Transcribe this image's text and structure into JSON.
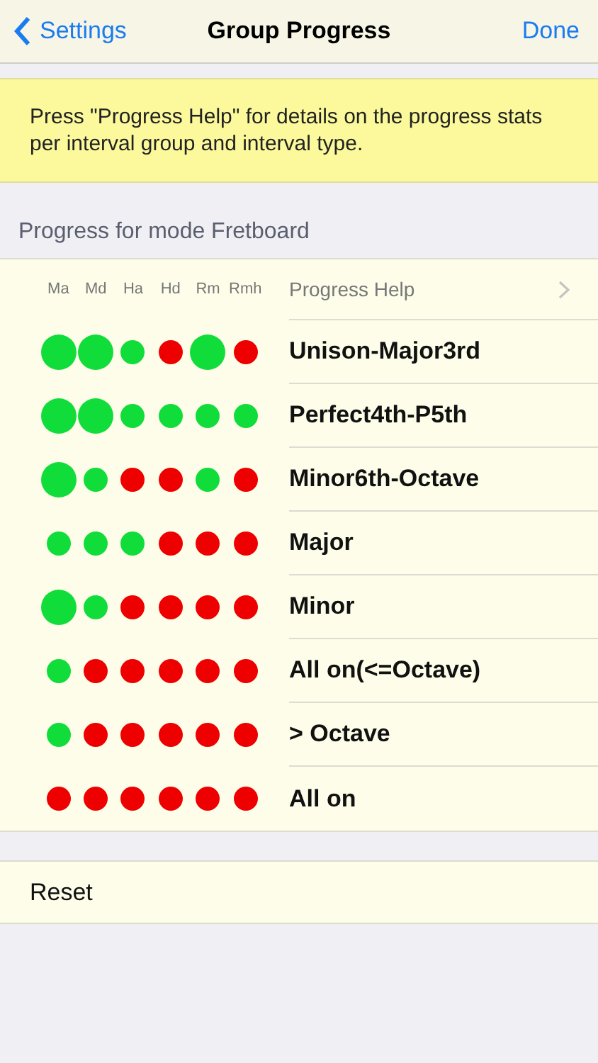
{
  "nav": {
    "back": "Settings",
    "title": "Group Progress",
    "done": "Done"
  },
  "notice": "Press \"Progress Help\" for details on the progress stats per interval group and interval type.",
  "section_title": "Progress for mode Fretboard",
  "columns": [
    "Ma",
    "Md",
    "Ha",
    "Hd",
    "Rm",
    "Rmh"
  ],
  "help_row": {
    "label": "Progress Help"
  },
  "rows": [
    {
      "label": "Unison-Major3rd",
      "dots": [
        {
          "kind": "large",
          "color": "#11dd3a"
        },
        {
          "kind": "large",
          "color": "#11dd3a"
        },
        {
          "kind": "small",
          "color": "#11dd3a"
        },
        {
          "kind": "small",
          "color": "#ee0000"
        },
        {
          "kind": "large",
          "color": "#11dd3a"
        },
        {
          "kind": "small",
          "color": "#ee0000"
        }
      ]
    },
    {
      "label": "Perfect4th-P5th",
      "dots": [
        {
          "kind": "large",
          "color": "#11dd3a"
        },
        {
          "kind": "large",
          "color": "#11dd3a"
        },
        {
          "kind": "small",
          "color": "#11dd3a"
        },
        {
          "kind": "small",
          "color": "#11dd3a"
        },
        {
          "kind": "small",
          "color": "#11dd3a"
        },
        {
          "kind": "small",
          "color": "#11dd3a"
        }
      ]
    },
    {
      "label": "Minor6th-Octave",
      "dots": [
        {
          "kind": "large",
          "color": "#11dd3a"
        },
        {
          "kind": "small",
          "color": "#11dd3a"
        },
        {
          "kind": "small",
          "color": "#ee0000"
        },
        {
          "kind": "small",
          "color": "#ee0000"
        },
        {
          "kind": "small",
          "color": "#11dd3a"
        },
        {
          "kind": "small",
          "color": "#ee0000"
        }
      ]
    },
    {
      "label": "Major",
      "dots": [
        {
          "kind": "small",
          "color": "#11dd3a"
        },
        {
          "kind": "small",
          "color": "#11dd3a"
        },
        {
          "kind": "small",
          "color": "#11dd3a"
        },
        {
          "kind": "small",
          "color": "#ee0000"
        },
        {
          "kind": "small",
          "color": "#ee0000"
        },
        {
          "kind": "small",
          "color": "#ee0000"
        }
      ]
    },
    {
      "label": "Minor",
      "dots": [
        {
          "kind": "large",
          "color": "#11dd3a"
        },
        {
          "kind": "small",
          "color": "#11dd3a"
        },
        {
          "kind": "small",
          "color": "#ee0000"
        },
        {
          "kind": "small",
          "color": "#ee0000"
        },
        {
          "kind": "small",
          "color": "#ee0000"
        },
        {
          "kind": "small",
          "color": "#ee0000"
        }
      ]
    },
    {
      "label": "All on(<=Octave)",
      "dots": [
        {
          "kind": "small",
          "color": "#11dd3a"
        },
        {
          "kind": "small",
          "color": "#ee0000"
        },
        {
          "kind": "small",
          "color": "#ee0000"
        },
        {
          "kind": "small",
          "color": "#ee0000"
        },
        {
          "kind": "small",
          "color": "#ee0000"
        },
        {
          "kind": "small",
          "color": "#ee0000"
        }
      ]
    },
    {
      "label": "> Octave",
      "dots": [
        {
          "kind": "small",
          "color": "#11dd3a"
        },
        {
          "kind": "small",
          "color": "#ee0000"
        },
        {
          "kind": "small",
          "color": "#ee0000"
        },
        {
          "kind": "small",
          "color": "#ee0000"
        },
        {
          "kind": "small",
          "color": "#ee0000"
        },
        {
          "kind": "small",
          "color": "#ee0000"
        }
      ]
    },
    {
      "label": "All on",
      "dots": [
        {
          "kind": "small",
          "color": "#ee0000"
        },
        {
          "kind": "small",
          "color": "#ee0000"
        },
        {
          "kind": "small",
          "color": "#ee0000"
        },
        {
          "kind": "small",
          "color": "#ee0000"
        },
        {
          "kind": "small",
          "color": "#ee0000"
        },
        {
          "kind": "small",
          "color": "#ee0000"
        }
      ]
    }
  ],
  "reset": "Reset"
}
